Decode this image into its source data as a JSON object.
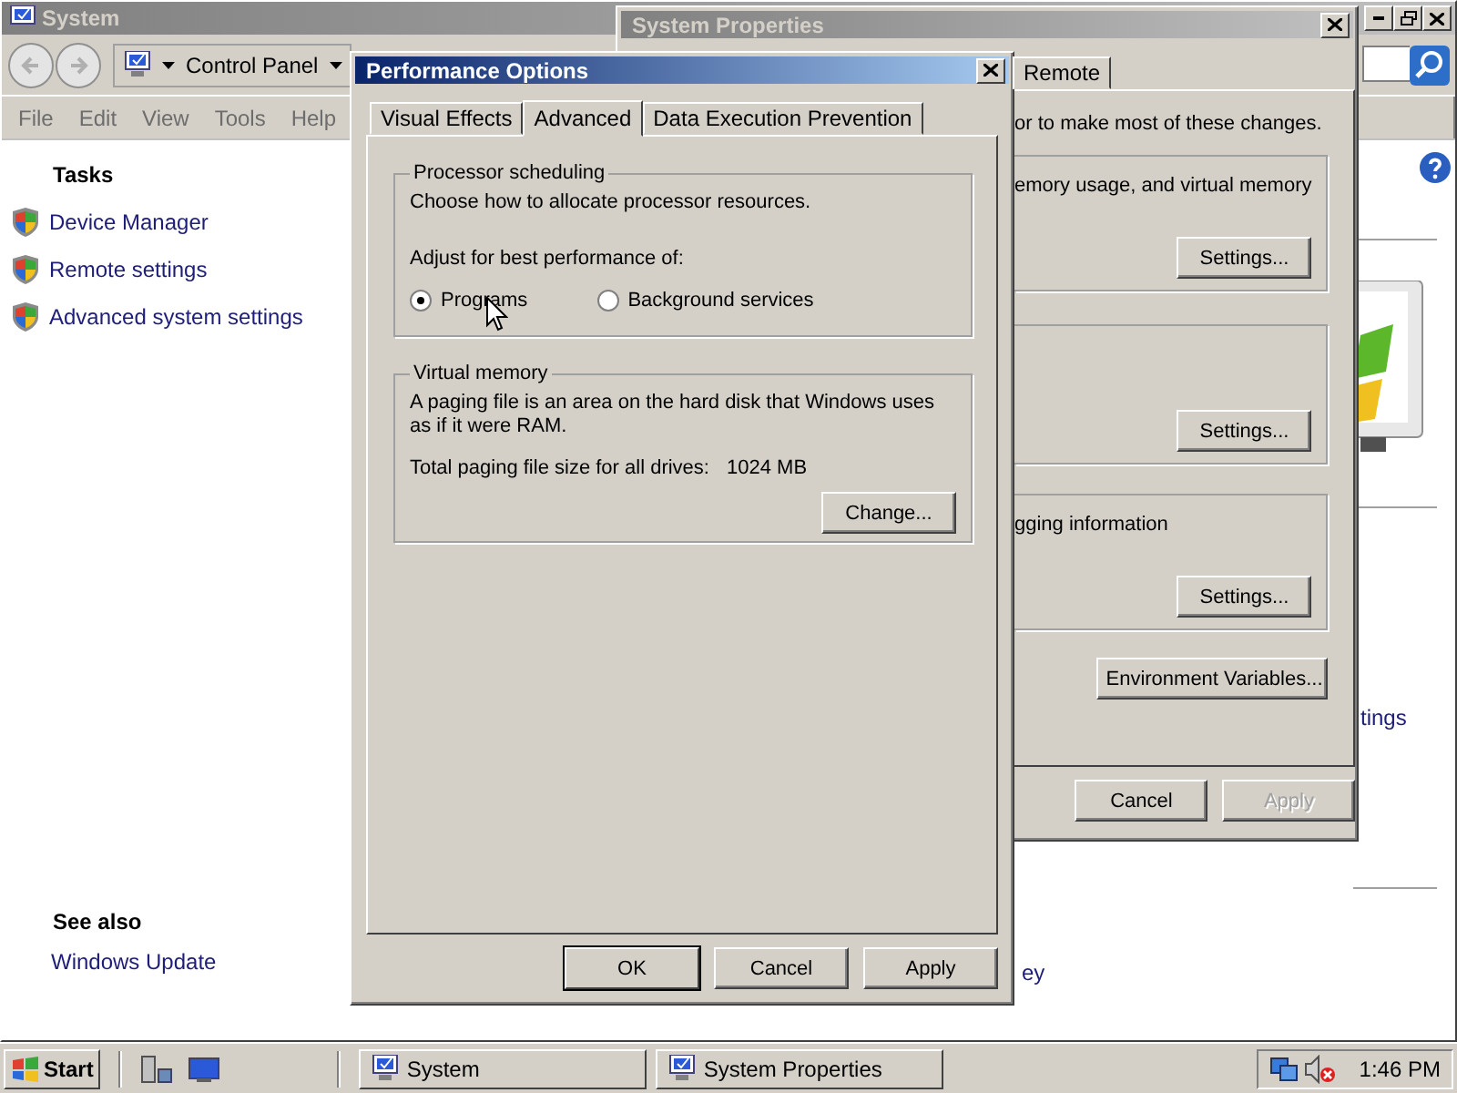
{
  "system_window": {
    "title": "System",
    "address": "Control Panel",
    "menu": [
      "File",
      "Edit",
      "View",
      "Tools",
      "Help"
    ],
    "tasks": {
      "heading": "Tasks",
      "items": [
        "Device Manager",
        "Remote settings",
        "Advanced system settings"
      ]
    },
    "see_also": {
      "heading": "See also",
      "items": [
        "Windows Update"
      ]
    },
    "clipped_link_right": "tings",
    "clipped_link_bottom": "ey"
  },
  "system_properties": {
    "title": "System Properties",
    "tabs": [
      {
        "label": "Remote",
        "selected": false
      }
    ],
    "intro": "or to make most of these changes.",
    "groups": [
      {
        "text": "emory usage, and virtual memory",
        "button": "Settings..."
      },
      {
        "button": "Settings..."
      },
      {
        "text": "gging information",
        "button": "Settings..."
      }
    ],
    "environment_button": "Environment Variables...",
    "buttons": [
      {
        "label": "Cancel",
        "disabled": false
      },
      {
        "label": "Apply",
        "disabled": true
      }
    ]
  },
  "performance_options": {
    "title": "Performance Options",
    "tabs": [
      {
        "label": "Visual Effects",
        "selected": false
      },
      {
        "label": "Advanced",
        "selected": true
      },
      {
        "label": "Data Execution Prevention",
        "selected": false
      }
    ],
    "processor": {
      "legend": "Processor scheduling",
      "description": "Choose how to allocate processor resources.",
      "prompt": "Adjust for best performance of:",
      "options": [
        {
          "label": "Programs",
          "selected": true
        },
        {
          "label": "Background services",
          "selected": false
        }
      ]
    },
    "virtual_memory": {
      "legend": "Virtual memory",
      "description": "A paging file is an area on the hard disk that Windows uses as if it were RAM.",
      "total_label": "Total paging file size for all drives:",
      "total_value": "1024 MB",
      "button": "Change..."
    },
    "buttons": [
      {
        "label": "OK",
        "default": true
      },
      {
        "label": "Cancel",
        "default": false
      },
      {
        "label": "Apply",
        "default": false
      }
    ]
  },
  "taskbar": {
    "start": "Start",
    "tasks": [
      "System",
      "System Properties"
    ],
    "clock": "1:46 PM"
  }
}
